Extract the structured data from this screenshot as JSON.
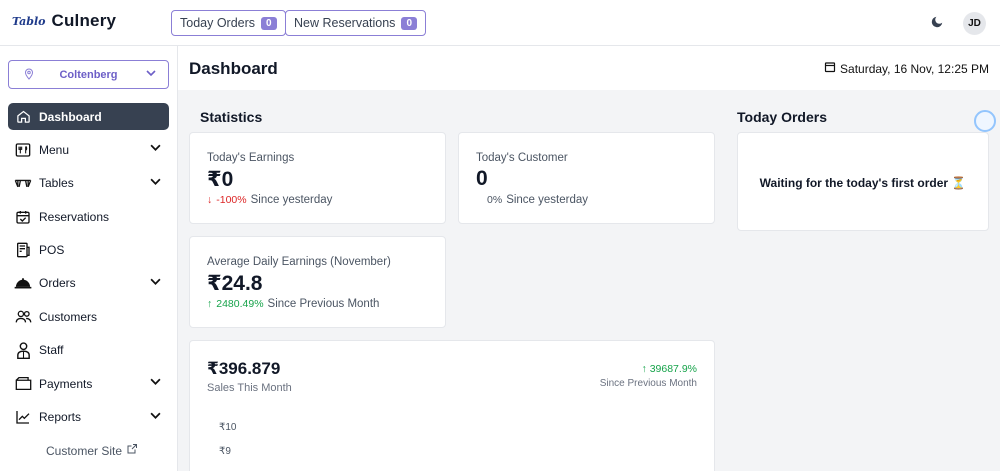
{
  "brand": {
    "mark": "Tablo",
    "name": "Culnery"
  },
  "topbar": {
    "today_orders": {
      "label": "Today Orders",
      "count": "0"
    },
    "new_reservations": {
      "label": "New Reservations",
      "count": "0"
    },
    "avatar_initials": "JD"
  },
  "sidebar": {
    "location": "Coltenberg",
    "items": [
      {
        "label": "Dashboard",
        "icon": "home-icon",
        "active": true,
        "expandable": false
      },
      {
        "label": "Menu",
        "icon": "cutlery-icon",
        "expandable": true
      },
      {
        "label": "Tables",
        "icon": "table-icon",
        "expandable": true
      },
      {
        "label": "Reservations",
        "icon": "calendar-check-icon",
        "expandable": false
      },
      {
        "label": "POS",
        "icon": "pos-icon",
        "expandable": false
      },
      {
        "label": "Orders",
        "icon": "cloche-icon",
        "expandable": true
      },
      {
        "label": "Customers",
        "icon": "users-icon",
        "expandable": false
      },
      {
        "label": "Staff",
        "icon": "staff-icon",
        "expandable": false
      },
      {
        "label": "Payments",
        "icon": "wallet-icon",
        "expandable": true
      },
      {
        "label": "Reports",
        "icon": "chart-line-icon",
        "expandable": true
      }
    ],
    "customer_site": "Customer Site"
  },
  "header": {
    "title": "Dashboard",
    "date": "Saturday, 16 Nov, 12:25 PM"
  },
  "statistics": {
    "title": "Statistics",
    "todays_earnings": {
      "label": "Today's Earnings",
      "value": "₹0",
      "change": "-100%",
      "since": "Since yesterday"
    },
    "todays_customer": {
      "label": "Today's Customer",
      "value": "0",
      "change": "0%",
      "since": "Since yesterday"
    },
    "avg_daily": {
      "label": "Average Daily Earnings (November)",
      "value": "₹24.8",
      "change": "2480.49%",
      "since": "Since Previous Month"
    },
    "sales": {
      "value": "₹396.879",
      "label": "Sales This Month",
      "change": "39687.9%",
      "since": "Since Previous Month",
      "yticks": [
        "₹10",
        "₹9"
      ]
    }
  },
  "today_orders": {
    "title": "Today Orders",
    "empty_message": "Waiting for the today's first order ⏳"
  },
  "colors": {
    "accent": "#8b7fd6",
    "active_nav": "#374151",
    "positive": "#16a34a",
    "negative": "#dc2626"
  }
}
